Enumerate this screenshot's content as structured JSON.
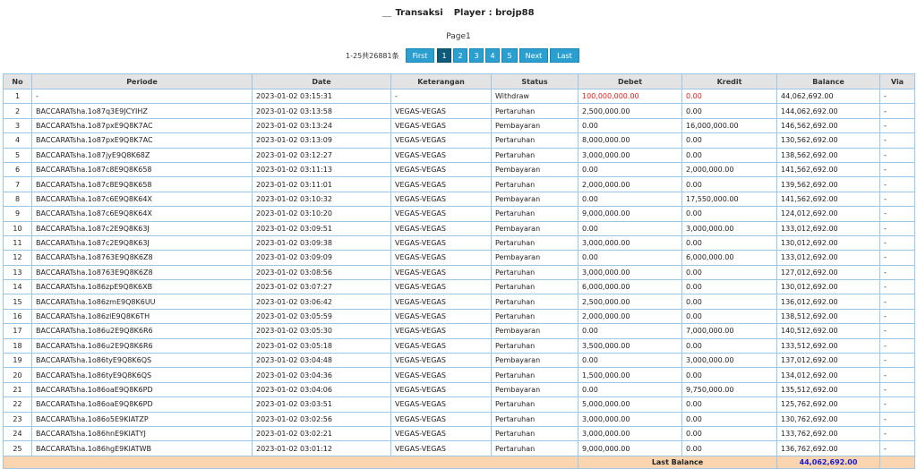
{
  "header": {
    "transaksi_label": "Transaksi",
    "player_label": "Player : brojp88"
  },
  "page_label": "Page1",
  "pager": {
    "summary": "1-25共26881条",
    "first": "First",
    "pages": [
      "1",
      "2",
      "3",
      "4",
      "5"
    ],
    "active_page": "1",
    "next": "Next",
    "last": "Last"
  },
  "table": {
    "columns": [
      "No",
      "Periode",
      "Date",
      "Keterangan",
      "Status",
      "Debet",
      "Kredit",
      "Balance",
      "Via"
    ],
    "rows": [
      [
        "1",
        "-",
        "2023-01-02 03:15:31",
        "-",
        "Withdraw",
        "100,000,000.00",
        "0.00",
        "44,062,692.00",
        "-"
      ],
      [
        "2",
        "BACCARATsha.1o87q3E9JCYIHZ",
        "2023-01-02 03:13:58",
        "VEGAS-VEGAS",
        "Pertaruhan",
        "2,500,000.00",
        "0.00",
        "144,062,692.00",
        "-"
      ],
      [
        "3",
        "BACCARATsha.1o87pxE9Q8K7AC",
        "2023-01-02 03:13:24",
        "VEGAS-VEGAS",
        "Pembayaran",
        "0.00",
        "16,000,000.00",
        "146,562,692.00",
        "-"
      ],
      [
        "4",
        "BACCARATsha.1o87pxE9Q8K7AC",
        "2023-01-02 03:13:09",
        "VEGAS-VEGAS",
        "Pertaruhan",
        "8,000,000.00",
        "0.00",
        "130,562,692.00",
        "-"
      ],
      [
        "5",
        "BACCARATsha.1o87jyE9Q8K68Z",
        "2023-01-02 03:12:27",
        "VEGAS-VEGAS",
        "Pertaruhan",
        "3,000,000.00",
        "0.00",
        "138,562,692.00",
        "-"
      ],
      [
        "6",
        "BACCARATsha.1o87c8E9Q8K658",
        "2023-01-02 03:11:13",
        "VEGAS-VEGAS",
        "Pembayaran",
        "0.00",
        "2,000,000.00",
        "141,562,692.00",
        "-"
      ],
      [
        "7",
        "BACCARATsha.1o87c8E9Q8K658",
        "2023-01-02 03:11:01",
        "VEGAS-VEGAS",
        "Pertaruhan",
        "2,000,000.00",
        "0.00",
        "139,562,692.00",
        "-"
      ],
      [
        "8",
        "BACCARATsha.1o87c6E9Q8K64X",
        "2023-01-02 03:10:32",
        "VEGAS-VEGAS",
        "Pembayaran",
        "0.00",
        "17,550,000.00",
        "141,562,692.00",
        "-"
      ],
      [
        "9",
        "BACCARATsha.1o87c6E9Q8K64X",
        "2023-01-02 03:10:20",
        "VEGAS-VEGAS",
        "Pertaruhan",
        "9,000,000.00",
        "0.00",
        "124,012,692.00",
        "-"
      ],
      [
        "10",
        "BACCARATsha.1o87c2E9Q8K63J",
        "2023-01-02 03:09:51",
        "VEGAS-VEGAS",
        "Pembayaran",
        "0.00",
        "3,000,000.00",
        "133,012,692.00",
        "-"
      ],
      [
        "11",
        "BACCARATsha.1o87c2E9Q8K63J",
        "2023-01-02 03:09:38",
        "VEGAS-VEGAS",
        "Pertaruhan",
        "3,000,000.00",
        "0.00",
        "130,012,692.00",
        "-"
      ],
      [
        "12",
        "BACCARATsha.1o8763E9Q8K6Z8",
        "2023-01-02 03:09:09",
        "VEGAS-VEGAS",
        "Pembayaran",
        "0.00",
        "6,000,000.00",
        "133,012,692.00",
        "-"
      ],
      [
        "13",
        "BACCARATsha.1o8763E9Q8K6Z8",
        "2023-01-02 03:08:56",
        "VEGAS-VEGAS",
        "Pertaruhan",
        "3,000,000.00",
        "0.00",
        "127,012,692.00",
        "-"
      ],
      [
        "14",
        "BACCARATsha.1o86zpE9Q8K6XB",
        "2023-01-02 03:07:27",
        "VEGAS-VEGAS",
        "Pertaruhan",
        "6,000,000.00",
        "0.00",
        "130,012,692.00",
        "-"
      ],
      [
        "15",
        "BACCARATsha.1o86zmE9Q8K6UU",
        "2023-01-02 03:06:42",
        "VEGAS-VEGAS",
        "Pertaruhan",
        "2,500,000.00",
        "0.00",
        "136,012,692.00",
        "-"
      ],
      [
        "16",
        "BACCARATsha.1o86zlE9Q8K6TH",
        "2023-01-02 03:05:59",
        "VEGAS-VEGAS",
        "Pertaruhan",
        "2,000,000.00",
        "0.00",
        "138,512,692.00",
        "-"
      ],
      [
        "17",
        "BACCARATsha.1o86u2E9Q8K6R6",
        "2023-01-02 03:05:30",
        "VEGAS-VEGAS",
        "Pembayaran",
        "0.00",
        "7,000,000.00",
        "140,512,692.00",
        "-"
      ],
      [
        "18",
        "BACCARATsha.1o86u2E9Q8K6R6",
        "2023-01-02 03:05:18",
        "VEGAS-VEGAS",
        "Pertaruhan",
        "3,500,000.00",
        "0.00",
        "133,512,692.00",
        "-"
      ],
      [
        "19",
        "BACCARATsha.1o86tyE9Q8K6QS",
        "2023-01-02 03:04:48",
        "VEGAS-VEGAS",
        "Pembayaran",
        "0.00",
        "3,000,000.00",
        "137,012,692.00",
        "-"
      ],
      [
        "20",
        "BACCARATsha.1o86tyE9Q8K6QS",
        "2023-01-02 03:04:36",
        "VEGAS-VEGAS",
        "Pertaruhan",
        "1,500,000.00",
        "0.00",
        "134,012,692.00",
        "-"
      ],
      [
        "21",
        "BACCARATsha.1o86oaE9Q8K6PD",
        "2023-01-02 03:04:06",
        "VEGAS-VEGAS",
        "Pembayaran",
        "0.00",
        "9,750,000.00",
        "135,512,692.00",
        "-"
      ],
      [
        "22",
        "BACCARATsha.1o86oaE9Q8K6PD",
        "2023-01-02 03:03:51",
        "VEGAS-VEGAS",
        "Pertaruhan",
        "5,000,000.00",
        "0.00",
        "125,762,692.00",
        "-"
      ],
      [
        "23",
        "BACCARATsha.1o86o5E9KIATZP",
        "2023-01-02 03:02:56",
        "VEGAS-VEGAS",
        "Pertaruhan",
        "3,000,000.00",
        "0.00",
        "130,762,692.00",
        "-"
      ],
      [
        "24",
        "BACCARATsha.1o86hnE9KIATYJ",
        "2023-01-02 03:02:21",
        "VEGAS-VEGAS",
        "Pertaruhan",
        "3,000,000.00",
        "0.00",
        "133,762,692.00",
        "-"
      ],
      [
        "25",
        "BACCARATsha.1o86hgE9KIATWB",
        "2023-01-02 03:01:12",
        "VEGAS-VEGAS",
        "Pertaruhan",
        "9,000,000.00",
        "0.00",
        "136,762,692.00",
        "-"
      ]
    ],
    "highlight_row_index": 0,
    "highlight_color": "#e02020",
    "footer": {
      "label": "Last Balance",
      "value": "44,062,692.00",
      "value_color": "#1a1acc",
      "background": "#fbd4b0"
    }
  },
  "colors": {
    "pager_button": "#2a9fd0",
    "pager_active": "#0d5a7a",
    "header_bg": "#e3e3e3",
    "border": "#9cc6e3"
  }
}
